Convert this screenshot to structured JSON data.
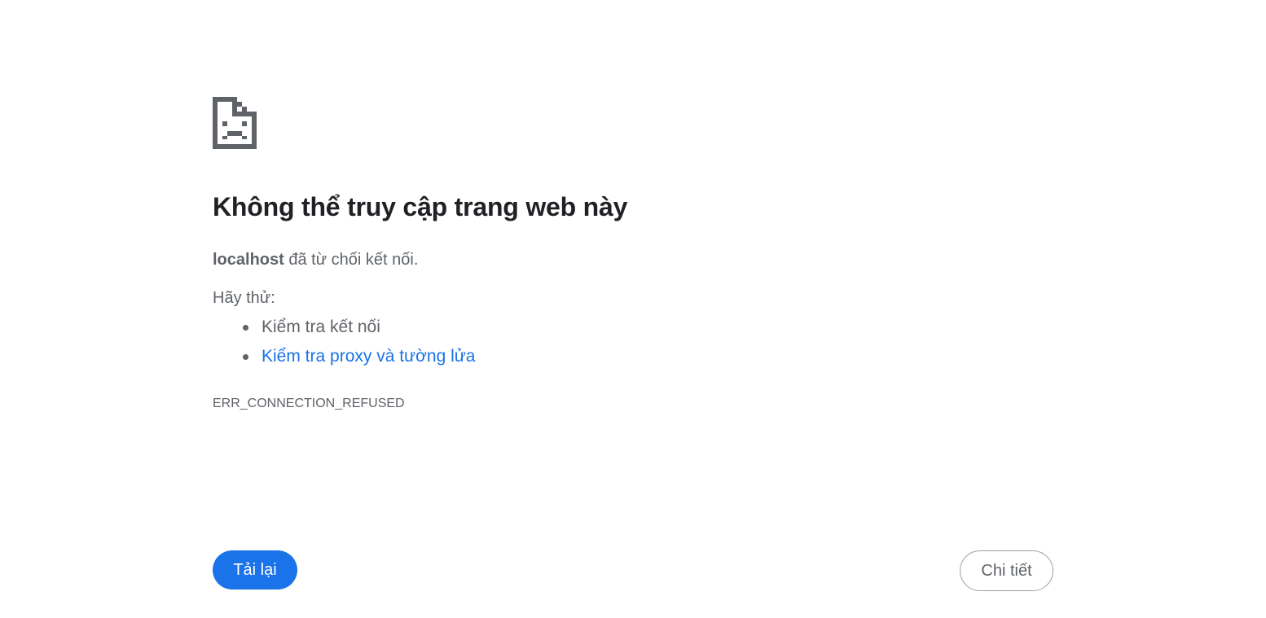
{
  "error_page": {
    "icon": "sad-page-icon",
    "title": "Không thể truy cập trang web này",
    "summary": {
      "host": "localhost",
      "message": " đã từ chối kết nối."
    },
    "try_label": "Hãy thử:",
    "suggestions": [
      {
        "text": "Kiểm tra kết nối",
        "is_link": false
      },
      {
        "text": "Kiểm tra proxy và tường lửa",
        "is_link": true
      }
    ],
    "error_code": "ERR_CONNECTION_REFUSED"
  },
  "buttons": {
    "reload_label": "Tải lại",
    "details_label": "Chi tiết"
  },
  "colors": {
    "accent": "#1a73e8",
    "text_primary": "#202124",
    "text_secondary": "#5f6368",
    "icon": "#5f6368",
    "background": "#ffffff"
  }
}
